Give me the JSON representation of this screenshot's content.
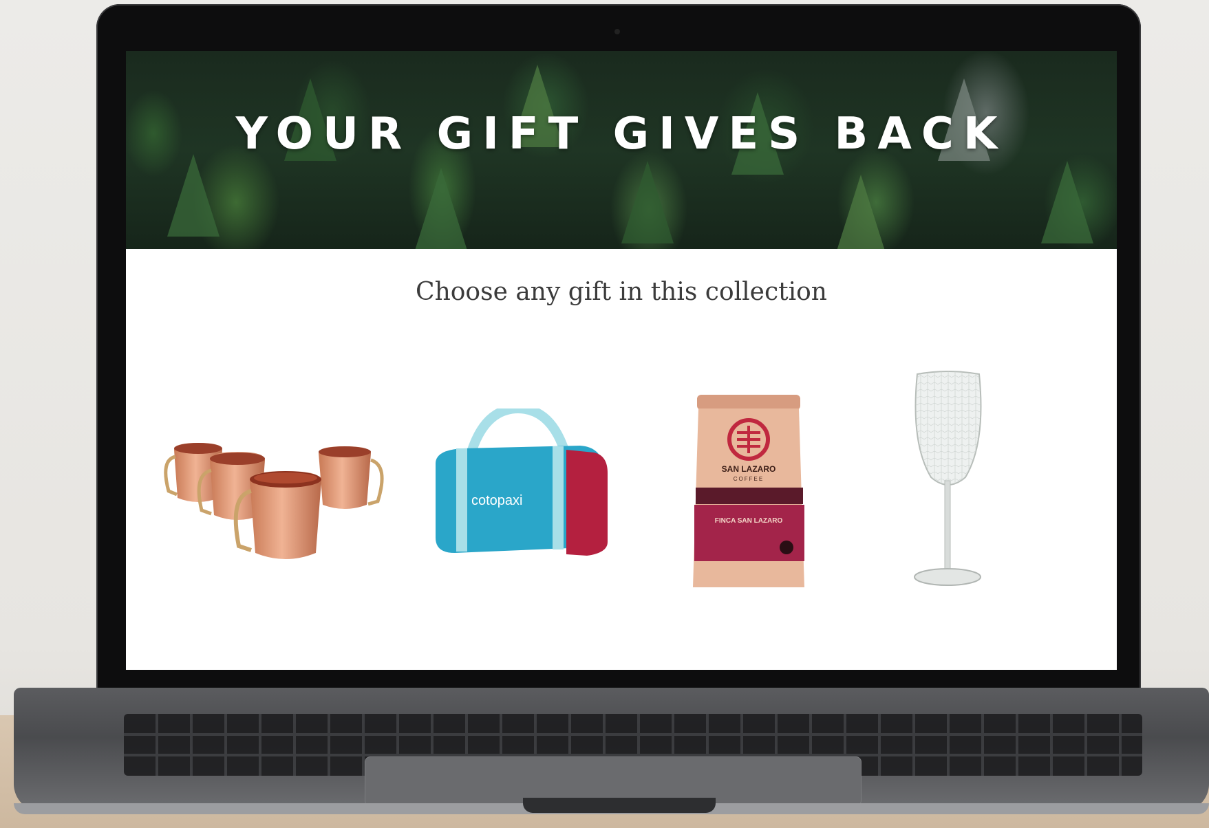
{
  "hero": {
    "title": "YOUR GIFT GIVES BACK"
  },
  "collection": {
    "heading": "Choose any gift in this collection"
  },
  "products": [
    {
      "name": "copper-mugs"
    },
    {
      "name": "cotopaxi-duffel",
      "brand_text": "cotopaxi"
    },
    {
      "name": "san-lazaro-coffee",
      "brand_text": "SAN LAZARO",
      "sub_text": "COFFEE",
      "band_text": "FINCA SAN LAZARO"
    },
    {
      "name": "etched-wine-glass"
    }
  ],
  "colors": {
    "copper": "#d98f6e",
    "duffel_blue": "#2aa6c9",
    "duffel_red": "#b4203f",
    "coffee_bag": "#e8b89c",
    "coffee_band": "#a3244a"
  }
}
